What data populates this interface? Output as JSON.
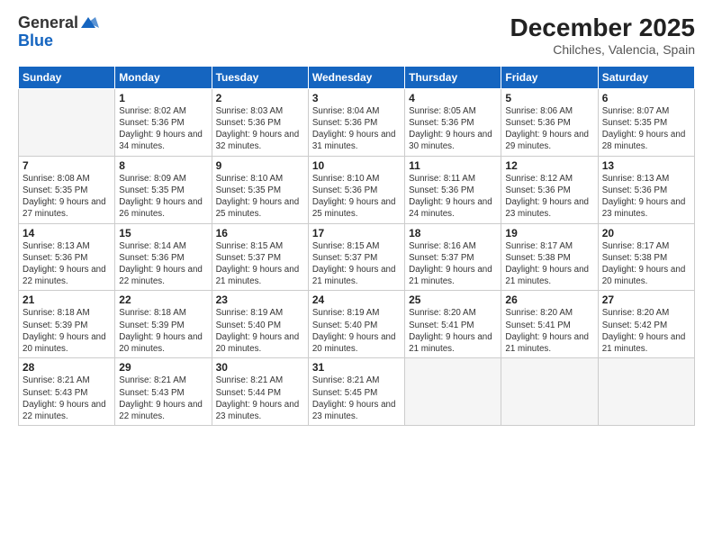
{
  "header": {
    "logo_general": "General",
    "logo_blue": "Blue",
    "title": "December 2025",
    "subtitle": "Chilches, Valencia, Spain"
  },
  "days_of_week": [
    "Sunday",
    "Monday",
    "Tuesday",
    "Wednesday",
    "Thursday",
    "Friday",
    "Saturday"
  ],
  "weeks": [
    [
      {
        "day": "",
        "sunrise": "",
        "sunset": "",
        "daylight": "",
        "empty": true
      },
      {
        "day": "1",
        "sunrise": "Sunrise: 8:02 AM",
        "sunset": "Sunset: 5:36 PM",
        "daylight": "Daylight: 9 hours and 34 minutes.",
        "empty": false
      },
      {
        "day": "2",
        "sunrise": "Sunrise: 8:03 AM",
        "sunset": "Sunset: 5:36 PM",
        "daylight": "Daylight: 9 hours and 32 minutes.",
        "empty": false
      },
      {
        "day": "3",
        "sunrise": "Sunrise: 8:04 AM",
        "sunset": "Sunset: 5:36 PM",
        "daylight": "Daylight: 9 hours and 31 minutes.",
        "empty": false
      },
      {
        "day": "4",
        "sunrise": "Sunrise: 8:05 AM",
        "sunset": "Sunset: 5:36 PM",
        "daylight": "Daylight: 9 hours and 30 minutes.",
        "empty": false
      },
      {
        "day": "5",
        "sunrise": "Sunrise: 8:06 AM",
        "sunset": "Sunset: 5:36 PM",
        "daylight": "Daylight: 9 hours and 29 minutes.",
        "empty": false
      },
      {
        "day": "6",
        "sunrise": "Sunrise: 8:07 AM",
        "sunset": "Sunset: 5:35 PM",
        "daylight": "Daylight: 9 hours and 28 minutes.",
        "empty": false
      }
    ],
    [
      {
        "day": "7",
        "sunrise": "Sunrise: 8:08 AM",
        "sunset": "Sunset: 5:35 PM",
        "daylight": "Daylight: 9 hours and 27 minutes.",
        "empty": false
      },
      {
        "day": "8",
        "sunrise": "Sunrise: 8:09 AM",
        "sunset": "Sunset: 5:35 PM",
        "daylight": "Daylight: 9 hours and 26 minutes.",
        "empty": false
      },
      {
        "day": "9",
        "sunrise": "Sunrise: 8:10 AM",
        "sunset": "Sunset: 5:35 PM",
        "daylight": "Daylight: 9 hours and 25 minutes.",
        "empty": false
      },
      {
        "day": "10",
        "sunrise": "Sunrise: 8:10 AM",
        "sunset": "Sunset: 5:36 PM",
        "daylight": "Daylight: 9 hours and 25 minutes.",
        "empty": false
      },
      {
        "day": "11",
        "sunrise": "Sunrise: 8:11 AM",
        "sunset": "Sunset: 5:36 PM",
        "daylight": "Daylight: 9 hours and 24 minutes.",
        "empty": false
      },
      {
        "day": "12",
        "sunrise": "Sunrise: 8:12 AM",
        "sunset": "Sunset: 5:36 PM",
        "daylight": "Daylight: 9 hours and 23 minutes.",
        "empty": false
      },
      {
        "day": "13",
        "sunrise": "Sunrise: 8:13 AM",
        "sunset": "Sunset: 5:36 PM",
        "daylight": "Daylight: 9 hours and 23 minutes.",
        "empty": false
      }
    ],
    [
      {
        "day": "14",
        "sunrise": "Sunrise: 8:13 AM",
        "sunset": "Sunset: 5:36 PM",
        "daylight": "Daylight: 9 hours and 22 minutes.",
        "empty": false
      },
      {
        "day": "15",
        "sunrise": "Sunrise: 8:14 AM",
        "sunset": "Sunset: 5:36 PM",
        "daylight": "Daylight: 9 hours and 22 minutes.",
        "empty": false
      },
      {
        "day": "16",
        "sunrise": "Sunrise: 8:15 AM",
        "sunset": "Sunset: 5:37 PM",
        "daylight": "Daylight: 9 hours and 21 minutes.",
        "empty": false
      },
      {
        "day": "17",
        "sunrise": "Sunrise: 8:15 AM",
        "sunset": "Sunset: 5:37 PM",
        "daylight": "Daylight: 9 hours and 21 minutes.",
        "empty": false
      },
      {
        "day": "18",
        "sunrise": "Sunrise: 8:16 AM",
        "sunset": "Sunset: 5:37 PM",
        "daylight": "Daylight: 9 hours and 21 minutes.",
        "empty": false
      },
      {
        "day": "19",
        "sunrise": "Sunrise: 8:17 AM",
        "sunset": "Sunset: 5:38 PM",
        "daylight": "Daylight: 9 hours and 21 minutes.",
        "empty": false
      },
      {
        "day": "20",
        "sunrise": "Sunrise: 8:17 AM",
        "sunset": "Sunset: 5:38 PM",
        "daylight": "Daylight: 9 hours and 20 minutes.",
        "empty": false
      }
    ],
    [
      {
        "day": "21",
        "sunrise": "Sunrise: 8:18 AM",
        "sunset": "Sunset: 5:39 PM",
        "daylight": "Daylight: 9 hours and 20 minutes.",
        "empty": false
      },
      {
        "day": "22",
        "sunrise": "Sunrise: 8:18 AM",
        "sunset": "Sunset: 5:39 PM",
        "daylight": "Daylight: 9 hours and 20 minutes.",
        "empty": false
      },
      {
        "day": "23",
        "sunrise": "Sunrise: 8:19 AM",
        "sunset": "Sunset: 5:40 PM",
        "daylight": "Daylight: 9 hours and 20 minutes.",
        "empty": false
      },
      {
        "day": "24",
        "sunrise": "Sunrise: 8:19 AM",
        "sunset": "Sunset: 5:40 PM",
        "daylight": "Daylight: 9 hours and 20 minutes.",
        "empty": false
      },
      {
        "day": "25",
        "sunrise": "Sunrise: 8:20 AM",
        "sunset": "Sunset: 5:41 PM",
        "daylight": "Daylight: 9 hours and 21 minutes.",
        "empty": false
      },
      {
        "day": "26",
        "sunrise": "Sunrise: 8:20 AM",
        "sunset": "Sunset: 5:41 PM",
        "daylight": "Daylight: 9 hours and 21 minutes.",
        "empty": false
      },
      {
        "day": "27",
        "sunrise": "Sunrise: 8:20 AM",
        "sunset": "Sunset: 5:42 PM",
        "daylight": "Daylight: 9 hours and 21 minutes.",
        "empty": false
      }
    ],
    [
      {
        "day": "28",
        "sunrise": "Sunrise: 8:21 AM",
        "sunset": "Sunset: 5:43 PM",
        "daylight": "Daylight: 9 hours and 22 minutes.",
        "empty": false
      },
      {
        "day": "29",
        "sunrise": "Sunrise: 8:21 AM",
        "sunset": "Sunset: 5:43 PM",
        "daylight": "Daylight: 9 hours and 22 minutes.",
        "empty": false
      },
      {
        "day": "30",
        "sunrise": "Sunrise: 8:21 AM",
        "sunset": "Sunset: 5:44 PM",
        "daylight": "Daylight: 9 hours and 23 minutes.",
        "empty": false
      },
      {
        "day": "31",
        "sunrise": "Sunrise: 8:21 AM",
        "sunset": "Sunset: 5:45 PM",
        "daylight": "Daylight: 9 hours and 23 minutes.",
        "empty": false
      },
      {
        "day": "",
        "sunrise": "",
        "sunset": "",
        "daylight": "",
        "empty": true
      },
      {
        "day": "",
        "sunrise": "",
        "sunset": "",
        "daylight": "",
        "empty": true
      },
      {
        "day": "",
        "sunrise": "",
        "sunset": "",
        "daylight": "",
        "empty": true
      }
    ]
  ]
}
